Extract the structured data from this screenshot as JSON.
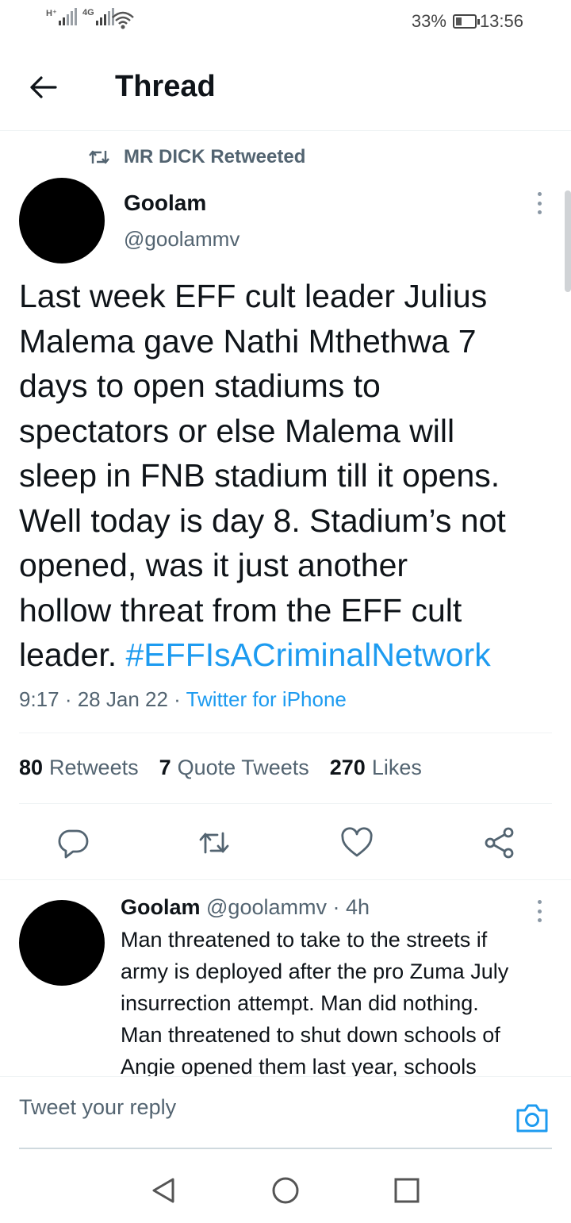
{
  "status_bar": {
    "sim1_label": "H⁺",
    "sim2_label": "4G",
    "battery_percent": "33%",
    "battery_level": 0.33,
    "time": "13:56"
  },
  "header": {
    "title": "Thread"
  },
  "tweet": {
    "retweeted_by": "MR DICK Retweeted",
    "author_name": "Goolam",
    "author_handle": "@goolammv",
    "text": "Last week EFF cult leader Julius\nMalema gave  Nathi Mthethwa 7\ndays to open stadiums to\nspectators or else Malema will\nsleep in FNB stadium till it opens.\nWell today is day 8. Stadium’s not\nopened, was it just another\nhollow threat from the EFF cult\nleader. ",
    "hashtag": "#EFFIsACriminalNetwork",
    "time_date": "9:17 · 28 Jan 22 · ",
    "source": "Twitter for iPhone",
    "stats": {
      "retweets_count": "80",
      "retweets_label": "Retweets",
      "quotes_count": "7",
      "quotes_label": "Quote Tweets",
      "likes_count": "270",
      "likes_label": "Likes"
    },
    "actions": [
      "reply-icon",
      "retweet-icon",
      "like-icon",
      "share-icon"
    ]
  },
  "reply": {
    "author_name": "Goolam",
    "author_handle": " @goolammv · 4h",
    "text": "Man threatened to take to the streets if\narmy is deployed after the pro Zuma July\ninsurrection attempt.  Man did nothing.\nMan threatened to shut down schools of\nAngie opened them last year, schools"
  },
  "composer": {
    "placeholder": "Tweet your reply"
  },
  "colors": {
    "accent": "#1d9bf0",
    "secondary_text": "#536471",
    "primary_text": "#0f1419"
  },
  "nav": [
    "back-triangle-icon",
    "home-circle-icon",
    "recents-square-icon"
  ]
}
